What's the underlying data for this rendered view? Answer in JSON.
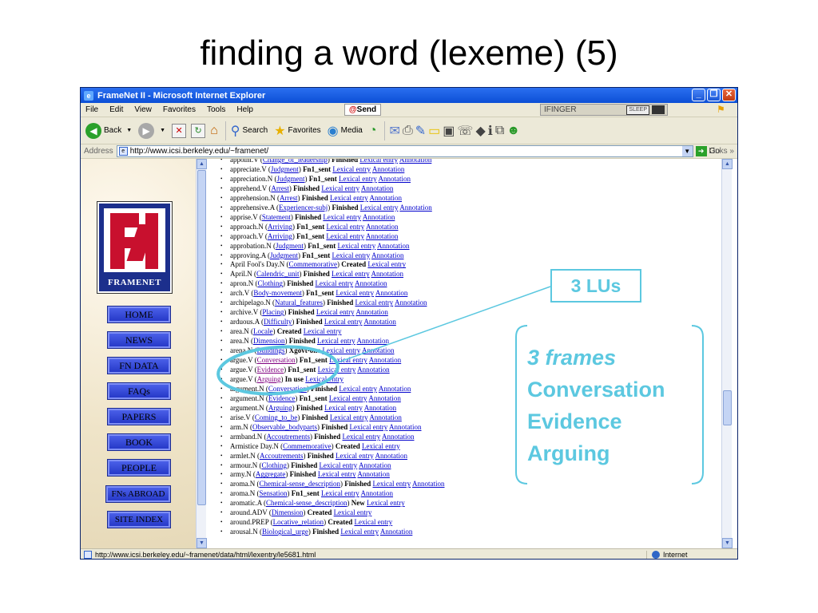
{
  "slide": {
    "title": "finding a word (lexeme) (5)"
  },
  "window": {
    "title": "FrameNet II - Microsoft Internet Explorer"
  },
  "menu": {
    "items": [
      "File",
      "Edit",
      "View",
      "Favorites",
      "Tools",
      "Help"
    ],
    "send_label": "Send",
    "ifinger_label": "IFINGER",
    "sleep_label": "SLEEP"
  },
  "toolbar": {
    "back_label": "Back",
    "search_label": "Search",
    "favorites_label": "Favorites",
    "media_label": "Media"
  },
  "address": {
    "label": "Address",
    "url": "http://www.icsi.berkeley.edu/~framenet/",
    "go_label": "Go",
    "links_label": "Links"
  },
  "left_nav": {
    "logo_label": "FRAMENET",
    "buttons": [
      "HOME",
      "NEWS",
      "FN DATA",
      "FAQs",
      "PAPERS",
      "BOOK",
      "PEOPLE",
      "FNs ABROAD",
      "SITE INDEX"
    ]
  },
  "lexical_units": [
    {
      "lemma": "appoint.V",
      "frame": "Change_of_leadership",
      "status": "Finished",
      "links": [
        "Lexical entry",
        "Annotation"
      ]
    },
    {
      "lemma": "appreciate.V",
      "frame": "Judgment",
      "status": "Fn1_sent",
      "links": [
        "Lexical entry",
        "Annotation"
      ]
    },
    {
      "lemma": "appreciation.N",
      "frame": "Judgment",
      "status": "Fn1_sent",
      "links": [
        "Lexical entry",
        "Annotation"
      ]
    },
    {
      "lemma": "apprehend.V",
      "frame": "Arrest",
      "status": "Finished",
      "links": [
        "Lexical entry",
        "Annotation"
      ]
    },
    {
      "lemma": "apprehension.N",
      "frame": "Arrest",
      "status": "Finished",
      "links": [
        "Lexical entry",
        "Annotation"
      ]
    },
    {
      "lemma": "apprehensive.A",
      "frame": "Experiencer-subj",
      "status": "Finished",
      "links": [
        "Lexical entry",
        "Annotation"
      ]
    },
    {
      "lemma": "apprise.V",
      "frame": "Statement",
      "status": "Finished",
      "links": [
        "Lexical entry",
        "Annotation"
      ]
    },
    {
      "lemma": "approach.N",
      "frame": "Arriving",
      "status": "Fn1_sent",
      "links": [
        "Lexical entry",
        "Annotation"
      ]
    },
    {
      "lemma": "approach.V",
      "frame": "Arriving",
      "status": "Fn1_sent",
      "links": [
        "Lexical entry",
        "Annotation"
      ]
    },
    {
      "lemma": "approbation.N",
      "frame": "Judgment",
      "status": "Fn1_sent",
      "links": [
        "Lexical entry",
        "Annotation"
      ]
    },
    {
      "lemma": "approving.A",
      "frame": "Judgment",
      "status": "Fn1_sent",
      "links": [
        "Lexical entry",
        "Annotation"
      ]
    },
    {
      "lemma": "April Fool's Day.N",
      "frame": "Commemorative",
      "status": "Created",
      "links": [
        "Lexical entry"
      ]
    },
    {
      "lemma": "April.N",
      "frame": "Calendric_unit",
      "status": "Finished",
      "links": [
        "Lexical entry",
        "Annotation"
      ]
    },
    {
      "lemma": "apron.N",
      "frame": "Clothing",
      "status": "Finished",
      "links": [
        "Lexical entry",
        "Annotation"
      ]
    },
    {
      "lemma": "arch.V",
      "frame": "Body-movement",
      "status": "Fn1_sent",
      "links": [
        "Lexical entry",
        "Annotation"
      ]
    },
    {
      "lemma": "archipelago.N",
      "frame": "Natural_features",
      "status": "Finished",
      "links": [
        "Lexical entry",
        "Annotation"
      ]
    },
    {
      "lemma": "archive.V",
      "frame": "Placing",
      "status": "Finished",
      "links": [
        "Lexical entry",
        "Annotation"
      ]
    },
    {
      "lemma": "arduous.A",
      "frame": "Difficulty",
      "status": "Finished",
      "links": [
        "Lexical entry",
        "Annotation"
      ]
    },
    {
      "lemma": "area.N",
      "frame": "Locale",
      "status": "Created",
      "links": [
        "Lexical entry"
      ]
    },
    {
      "lemma": "area.N",
      "frame": "Dimension",
      "status": "Finished",
      "links": [
        "Lexical entry",
        "Annotation"
      ]
    },
    {
      "lemma": "arena.N",
      "frame": "Buildings",
      "status": "Xgovt-one",
      "links": [
        "Lexical entry",
        "Annotation"
      ]
    },
    {
      "lemma": "argue.V",
      "frame": "Conversation",
      "status": "Fn1_sent",
      "links": [
        "Lexical entry",
        "Annotation"
      ]
    },
    {
      "lemma": "argue.V",
      "frame": "Evidence",
      "status": "Fn1_sent",
      "links": [
        "Lexical entry",
        "Annotation"
      ]
    },
    {
      "lemma": "argue.V",
      "frame": "Arguing",
      "status": "In use",
      "links": [
        "Lexical entry"
      ]
    },
    {
      "lemma": "argument.N",
      "frame": "Conversation",
      "status": "Finished",
      "links": [
        "Lexical entry",
        "Annotation"
      ]
    },
    {
      "lemma": "argument.N",
      "frame": "Evidence",
      "status": "Fn1_sent",
      "links": [
        "Lexical entry",
        "Annotation"
      ]
    },
    {
      "lemma": "argument.N",
      "frame": "Arguing",
      "status": "Finished",
      "links": [
        "Lexical entry",
        "Annotation"
      ]
    },
    {
      "lemma": "arise.V",
      "frame": "Coming_to_be",
      "status": "Finished",
      "links": [
        "Lexical entry",
        "Annotation"
      ]
    },
    {
      "lemma": "arm.N",
      "frame": "Observable_bodyparts",
      "status": "Finished",
      "links": [
        "Lexical entry",
        "Annotation"
      ]
    },
    {
      "lemma": "armband.N",
      "frame": "Accoutrements",
      "status": "Finished",
      "links": [
        "Lexical entry",
        "Annotation"
      ]
    },
    {
      "lemma": "Armistice Day.N",
      "frame": "Commemorative",
      "status": "Created",
      "links": [
        "Lexical entry"
      ]
    },
    {
      "lemma": "armlet.N",
      "frame": "Accoutrements",
      "status": "Finished",
      "links": [
        "Lexical entry",
        "Annotation"
      ]
    },
    {
      "lemma": "armour.N",
      "frame": "Clothing",
      "status": "Finished",
      "links": [
        "Lexical entry",
        "Annotation"
      ]
    },
    {
      "lemma": "army.N",
      "frame": "Aggregate",
      "status": "Finished",
      "links": [
        "Lexical entry",
        "Annotation"
      ]
    },
    {
      "lemma": "aroma.N",
      "frame": "Chemical-sense_description",
      "status": "Finished",
      "links": [
        "Lexical entry",
        "Annotation"
      ]
    },
    {
      "lemma": "aroma.N",
      "frame": "Sensation",
      "status": "Fn1_sent",
      "links": [
        "Lexical entry",
        "Annotation"
      ]
    },
    {
      "lemma": "aromatic.A",
      "frame": "Chemical-sense_description",
      "status": "New",
      "links": [
        "Lexical entry"
      ]
    },
    {
      "lemma": "around.ADV",
      "frame": "Dimension",
      "status": "Created",
      "links": [
        "Lexical entry"
      ]
    },
    {
      "lemma": "around.PREP",
      "frame": "Locative_relation",
      "status": "Created",
      "links": [
        "Lexical entry"
      ]
    },
    {
      "lemma": "arousal.N",
      "frame": "Biological_urge",
      "status": "Finished",
      "links": [
        "Lexical entry",
        "Annotation"
      ]
    }
  ],
  "statusbar": {
    "url": "http://www.icsi.berkeley.edu/~framenet/data/html/lexentry/le5681.html",
    "zone": "Internet"
  },
  "annotations": {
    "lus_label": "3 LUs",
    "frames_heading": "3 frames",
    "frames": [
      "Conversation",
      "Evidence",
      "Arguing"
    ],
    "accent_color": "#5cc8e0"
  }
}
